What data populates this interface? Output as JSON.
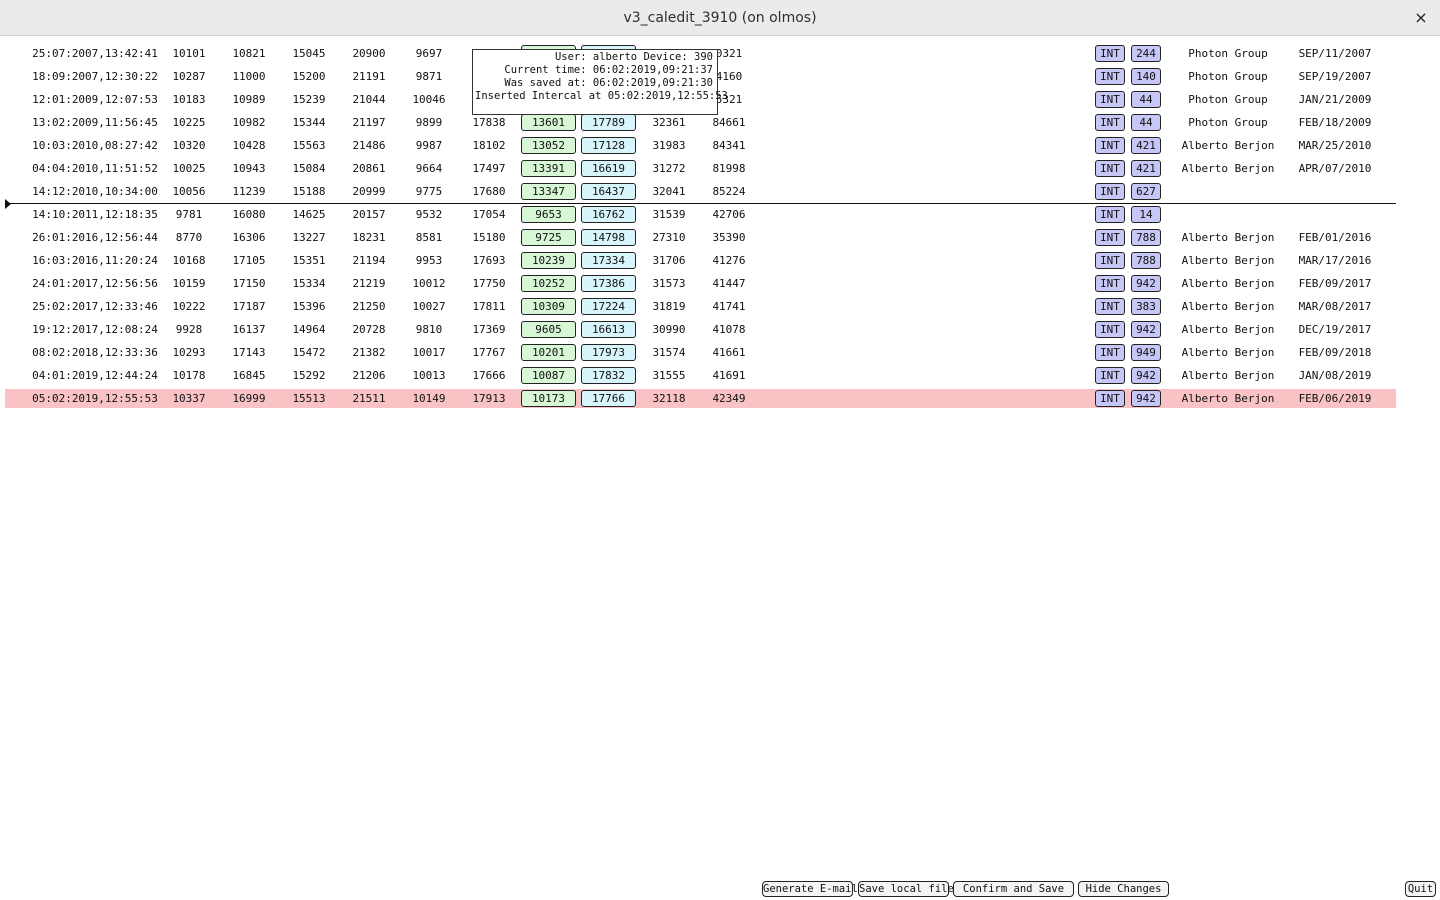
{
  "window": {
    "title": "v3_caledit_3910 (on olmos)",
    "close_glyph": "×"
  },
  "tooltip": {
    "lines": [
      "User: alberto Device: 390",
      "Current time: 06:02:2019,09:21:37",
      "Was saved at: 06:02:2019,09:21:30",
      "Inserted Intercal at 05:02:2019,12:55:53"
    ]
  },
  "rows": [
    {
      "ts": "25:07:2007,13:42:41",
      "n1": "10101",
      "n2": "10821",
      "n3": "15045",
      "n4": "20900",
      "n5": "9697",
      "n6": "",
      "g": "",
      "b": "",
      "n7": "",
      "n8": "0321",
      "type": "INT",
      "num": "244",
      "user": "Photon Group",
      "date": "SEP/11/2007"
    },
    {
      "ts": "18:09:2007,12:30:22",
      "n1": "10287",
      "n2": "11000",
      "n3": "15200",
      "n4": "21191",
      "n5": "9871",
      "n6": "",
      "g": "",
      "b": "",
      "n7": "",
      "n8": "4160",
      "type": "INT",
      "num": "140",
      "user": "Photon Group",
      "date": "SEP/19/2007"
    },
    {
      "ts": "12:01:2009,12:07:53",
      "n1": "10183",
      "n2": "10989",
      "n3": "15239",
      "n4": "21044",
      "n5": "10046",
      "n6": "",
      "g": "",
      "b": "",
      "n7": "",
      "n8": "5321",
      "type": "INT",
      "num": "44",
      "user": "Photon Group",
      "date": "JAN/21/2009"
    },
    {
      "ts": "13:02:2009,11:56:45",
      "n1": "10225",
      "n2": "10982",
      "n3": "15344",
      "n4": "21197",
      "n5": "9899",
      "n6": "17838",
      "g": "13601",
      "b": "17789",
      "n7": "32361",
      "n8": "84661",
      "type": "INT",
      "num": "44",
      "user": "Photon Group",
      "date": "FEB/18/2009"
    },
    {
      "ts": "10:03:2010,08:27:42",
      "n1": "10320",
      "n2": "10428",
      "n3": "15563",
      "n4": "21486",
      "n5": "9987",
      "n6": "18102",
      "g": "13052",
      "b": "17128",
      "n7": "31983",
      "n8": "84341",
      "type": "INT",
      "num": "421",
      "user": "Alberto Berjon",
      "date": "MAR/25/2010"
    },
    {
      "ts": "04:04:2010,11:51:52",
      "n1": "10025",
      "n2": "10943",
      "n3": "15084",
      "n4": "20861",
      "n5": "9664",
      "n6": "17497",
      "g": "13391",
      "b": "16619",
      "n7": "31272",
      "n8": "81998",
      "type": "INT",
      "num": "421",
      "user": "Alberto Berjon",
      "date": "APR/07/2010"
    },
    {
      "ts": "14:12:2010,10:34:00",
      "n1": "10056",
      "n2": "11239",
      "n3": "15188",
      "n4": "20999",
      "n5": "9775",
      "n6": "17680",
      "g": "13347",
      "b": "16437",
      "n7": "32041",
      "n8": "85224",
      "type": "INT",
      "num": "627",
      "user": "",
      "date": ""
    },
    {
      "ts": "14:10:2011,12:18:35",
      "n1": "9781",
      "n2": "16080",
      "n3": "14625",
      "n4": "20157",
      "n5": "9532",
      "n6": "17054",
      "g": "9653",
      "b": "16762",
      "n7": "31539",
      "n8": "42706",
      "type": "INT",
      "num": "14",
      "user": "",
      "date": ""
    },
    {
      "ts": "26:01:2016,12:56:44",
      "n1": "8770",
      "n2": "16306",
      "n3": "13227",
      "n4": "18231",
      "n5": "8581",
      "n6": "15180",
      "g": "9725",
      "b": "14798",
      "n7": "27310",
      "n8": "35390",
      "type": "INT",
      "num": "788",
      "user": "Alberto Berjon",
      "date": "FEB/01/2016"
    },
    {
      "ts": "16:03:2016,11:20:24",
      "n1": "10168",
      "n2": "17105",
      "n3": "15351",
      "n4": "21194",
      "n5": "9953",
      "n6": "17693",
      "g": "10239",
      "b": "17334",
      "n7": "31706",
      "n8": "41276",
      "type": "INT",
      "num": "788",
      "user": "Alberto Berjon",
      "date": "MAR/17/2016"
    },
    {
      "ts": "24:01:2017,12:56:56",
      "n1": "10159",
      "n2": "17150",
      "n3": "15334",
      "n4": "21219",
      "n5": "10012",
      "n6": "17750",
      "g": "10252",
      "b": "17386",
      "n7": "31573",
      "n8": "41447",
      "type": "INT",
      "num": "942",
      "user": "Alberto Berjon",
      "date": "FEB/09/2017"
    },
    {
      "ts": "25:02:2017,12:33:46",
      "n1": "10222",
      "n2": "17187",
      "n3": "15396",
      "n4": "21250",
      "n5": "10027",
      "n6": "17811",
      "g": "10309",
      "b": "17224",
      "n7": "31819",
      "n8": "41741",
      "type": "INT",
      "num": "383",
      "user": "Alberto Berjon",
      "date": "MAR/08/2017"
    },
    {
      "ts": "19:12:2017,12:08:24",
      "n1": "9928",
      "n2": "16137",
      "n3": "14964",
      "n4": "20728",
      "n5": "9810",
      "n6": "17369",
      "g": "9605",
      "b": "16613",
      "n7": "30990",
      "n8": "41078",
      "type": "INT",
      "num": "942",
      "user": "Alberto Berjon",
      "date": "DEC/19/2017"
    },
    {
      "ts": "08:02:2018,12:33:36",
      "n1": "10293",
      "n2": "17143",
      "n3": "15472",
      "n4": "21382",
      "n5": "10017",
      "n6": "17767",
      "g": "10201",
      "b": "17973",
      "n7": "31574",
      "n8": "41661",
      "type": "INT",
      "num": "949",
      "user": "Alberto Berjon",
      "date": "FEB/09/2018"
    },
    {
      "ts": "04:01:2019,12:44:24",
      "n1": "10178",
      "n2": "16845",
      "n3": "15292",
      "n4": "21206",
      "n5": "10013",
      "n6": "17666",
      "g": "10087",
      "b": "17832",
      "n7": "31555",
      "n8": "41691",
      "type": "INT",
      "num": "942",
      "user": "Alberto Berjon",
      "date": "JAN/08/2019"
    },
    {
      "ts": "05:02:2019,12:55:53",
      "n1": "10337",
      "n2": "16999",
      "n3": "15513",
      "n4": "21511",
      "n5": "10149",
      "n6": "17913",
      "g": "10173",
      "b": "17766",
      "n7": "32118",
      "n8": "42349",
      "type": "INT",
      "num": "942",
      "user": "Alberto Berjon",
      "date": "FEB/06/2019",
      "highlight": true
    }
  ],
  "buttons": {
    "generate_email": "Generate E-mail",
    "save_local": "Save local file",
    "confirm_save": "Confirm and Save",
    "hide_changes": "Hide Changes",
    "quit": "Quit"
  },
  "colors": {
    "highlight_row": "#f9c3c6",
    "green_cell": "#d7f7d7",
    "blue_cell": "#d7f5fa",
    "pill": "#c6c6f7"
  }
}
